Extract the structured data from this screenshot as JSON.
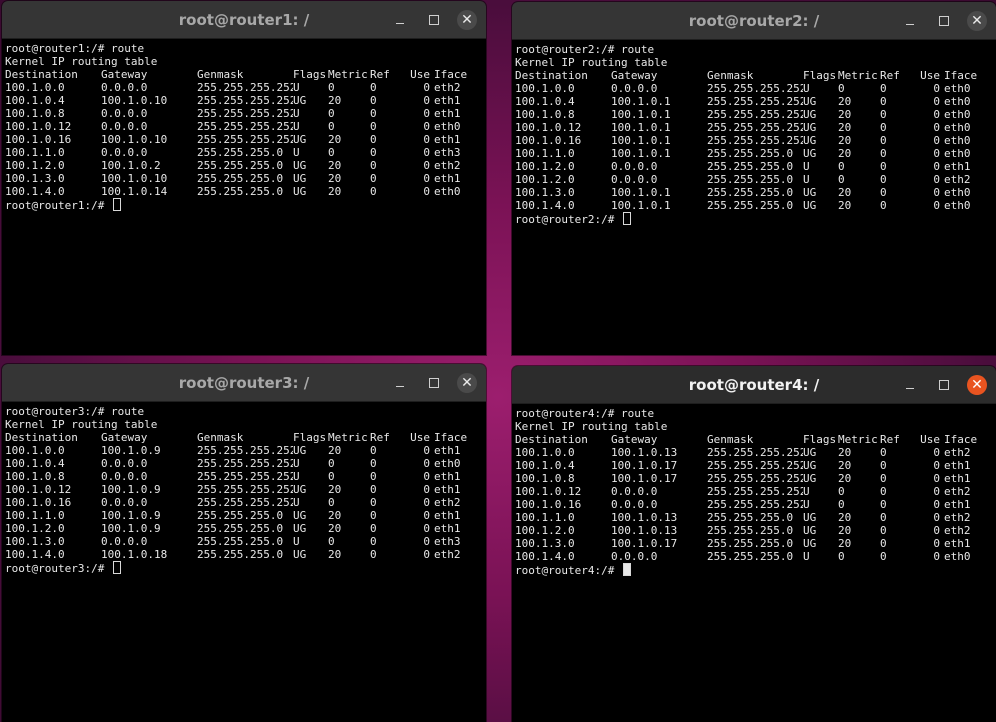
{
  "desktop": {
    "accent": "#e95420"
  },
  "windows": [
    {
      "id": "router1",
      "title": "root@router1: /",
      "active": false,
      "prompt": "root@router1:/#",
      "command": "route",
      "heading": "Kernel IP routing table",
      "columns": [
        "Destination",
        "Gateway",
        "Genmask",
        "Flags",
        "Metric",
        "Ref",
        "Use",
        "Iface"
      ],
      "rows": [
        [
          "100.1.0.0",
          "0.0.0.0",
          "255.255.255.252",
          "U",
          "0",
          "0",
          "0",
          "eth2"
        ],
        [
          "100.1.0.4",
          "100.1.0.10",
          "255.255.255.252",
          "UG",
          "20",
          "0",
          "0",
          "eth1"
        ],
        [
          "100.1.0.8",
          "0.0.0.0",
          "255.255.255.252",
          "U",
          "0",
          "0",
          "0",
          "eth1"
        ],
        [
          "100.1.0.12",
          "0.0.0.0",
          "255.255.255.252",
          "U",
          "0",
          "0",
          "0",
          "eth0"
        ],
        [
          "100.1.0.16",
          "100.1.0.10",
          "255.255.255.252",
          "UG",
          "20",
          "0",
          "0",
          "eth1"
        ],
        [
          "100.1.1.0",
          "0.0.0.0",
          "255.255.255.0",
          "U",
          "0",
          "0",
          "0",
          "eth3"
        ],
        [
          "100.1.2.0",
          "100.1.0.2",
          "255.255.255.0",
          "UG",
          "20",
          "0",
          "0",
          "eth2"
        ],
        [
          "100.1.3.0",
          "100.1.0.10",
          "255.255.255.0",
          "UG",
          "20",
          "0",
          "0",
          "eth1"
        ],
        [
          "100.1.4.0",
          "100.1.0.14",
          "255.255.255.0",
          "UG",
          "20",
          "0",
          "0",
          "eth0"
        ]
      ]
    },
    {
      "id": "router2",
      "title": "root@router2: /",
      "active": false,
      "prompt": "root@router2:/#",
      "command": "route",
      "heading": "Kernel IP routing table",
      "columns": [
        "Destination",
        "Gateway",
        "Genmask",
        "Flags",
        "Metric",
        "Ref",
        "Use",
        "Iface"
      ],
      "rows": [
        [
          "100.1.0.0",
          "0.0.0.0",
          "255.255.255.252",
          "U",
          "0",
          "0",
          "0",
          "eth0"
        ],
        [
          "100.1.0.4",
          "100.1.0.1",
          "255.255.255.252",
          "UG",
          "20",
          "0",
          "0",
          "eth0"
        ],
        [
          "100.1.0.8",
          "100.1.0.1",
          "255.255.255.252",
          "UG",
          "20",
          "0",
          "0",
          "eth0"
        ],
        [
          "100.1.0.12",
          "100.1.0.1",
          "255.255.255.252",
          "UG",
          "20",
          "0",
          "0",
          "eth0"
        ],
        [
          "100.1.0.16",
          "100.1.0.1",
          "255.255.255.252",
          "UG",
          "20",
          "0",
          "0",
          "eth0"
        ],
        [
          "100.1.1.0",
          "100.1.0.1",
          "255.255.255.0",
          "UG",
          "20",
          "0",
          "0",
          "eth0"
        ],
        [
          "100.1.2.0",
          "0.0.0.0",
          "255.255.255.0",
          "U",
          "0",
          "0",
          "0",
          "eth1"
        ],
        [
          "100.1.2.0",
          "0.0.0.0",
          "255.255.255.0",
          "U",
          "0",
          "0",
          "0",
          "eth2"
        ],
        [
          "100.1.3.0",
          "100.1.0.1",
          "255.255.255.0",
          "UG",
          "20",
          "0",
          "0",
          "eth0"
        ],
        [
          "100.1.4.0",
          "100.1.0.1",
          "255.255.255.0",
          "UG",
          "20",
          "0",
          "0",
          "eth0"
        ]
      ]
    },
    {
      "id": "router3",
      "title": "root@router3: /",
      "active": false,
      "prompt": "root@router3:/#",
      "command": "route",
      "heading": "Kernel IP routing table",
      "columns": [
        "Destination",
        "Gateway",
        "Genmask",
        "Flags",
        "Metric",
        "Ref",
        "Use",
        "Iface"
      ],
      "rows": [
        [
          "100.1.0.0",
          "100.1.0.9",
          "255.255.255.252",
          "UG",
          "20",
          "0",
          "0",
          "eth1"
        ],
        [
          "100.1.0.4",
          "0.0.0.0",
          "255.255.255.252",
          "U",
          "0",
          "0",
          "0",
          "eth0"
        ],
        [
          "100.1.0.8",
          "0.0.0.0",
          "255.255.255.252",
          "U",
          "0",
          "0",
          "0",
          "eth1"
        ],
        [
          "100.1.0.12",
          "100.1.0.9",
          "255.255.255.252",
          "UG",
          "20",
          "0",
          "0",
          "eth1"
        ],
        [
          "100.1.0.16",
          "0.0.0.0",
          "255.255.255.252",
          "U",
          "0",
          "0",
          "0",
          "eth2"
        ],
        [
          "100.1.1.0",
          "100.1.0.9",
          "255.255.255.0",
          "UG",
          "20",
          "0",
          "0",
          "eth1"
        ],
        [
          "100.1.2.0",
          "100.1.0.9",
          "255.255.255.0",
          "UG",
          "20",
          "0",
          "0",
          "eth1"
        ],
        [
          "100.1.3.0",
          "0.0.0.0",
          "255.255.255.0",
          "U",
          "0",
          "0",
          "0",
          "eth3"
        ],
        [
          "100.1.4.0",
          "100.1.0.18",
          "255.255.255.0",
          "UG",
          "20",
          "0",
          "0",
          "eth2"
        ]
      ]
    },
    {
      "id": "router4",
      "title": "root@router4: /",
      "active": true,
      "prompt": "root@router4:/#",
      "command": "route",
      "heading": "Kernel IP routing table",
      "columns": [
        "Destination",
        "Gateway",
        "Genmask",
        "Flags",
        "Metric",
        "Ref",
        "Use",
        "Iface"
      ],
      "rows": [
        [
          "100.1.0.0",
          "100.1.0.13",
          "255.255.255.252",
          "UG",
          "20",
          "0",
          "0",
          "eth2"
        ],
        [
          "100.1.0.4",
          "100.1.0.17",
          "255.255.255.252",
          "UG",
          "20",
          "0",
          "0",
          "eth1"
        ],
        [
          "100.1.0.8",
          "100.1.0.17",
          "255.255.255.252",
          "UG",
          "20",
          "0",
          "0",
          "eth1"
        ],
        [
          "100.1.0.12",
          "0.0.0.0",
          "255.255.255.252",
          "U",
          "0",
          "0",
          "0",
          "eth2"
        ],
        [
          "100.1.0.16",
          "0.0.0.0",
          "255.255.255.252",
          "U",
          "0",
          "0",
          "0",
          "eth1"
        ],
        [
          "100.1.1.0",
          "100.1.0.13",
          "255.255.255.0",
          "UG",
          "20",
          "0",
          "0",
          "eth2"
        ],
        [
          "100.1.2.0",
          "100.1.0.13",
          "255.255.255.0",
          "UG",
          "20",
          "0",
          "0",
          "eth2"
        ],
        [
          "100.1.3.0",
          "100.1.0.17",
          "255.255.255.0",
          "UG",
          "20",
          "0",
          "0",
          "eth1"
        ],
        [
          "100.1.4.0",
          "0.0.0.0",
          "255.255.255.0",
          "U",
          "0",
          "0",
          "0",
          "eth0"
        ]
      ]
    }
  ]
}
